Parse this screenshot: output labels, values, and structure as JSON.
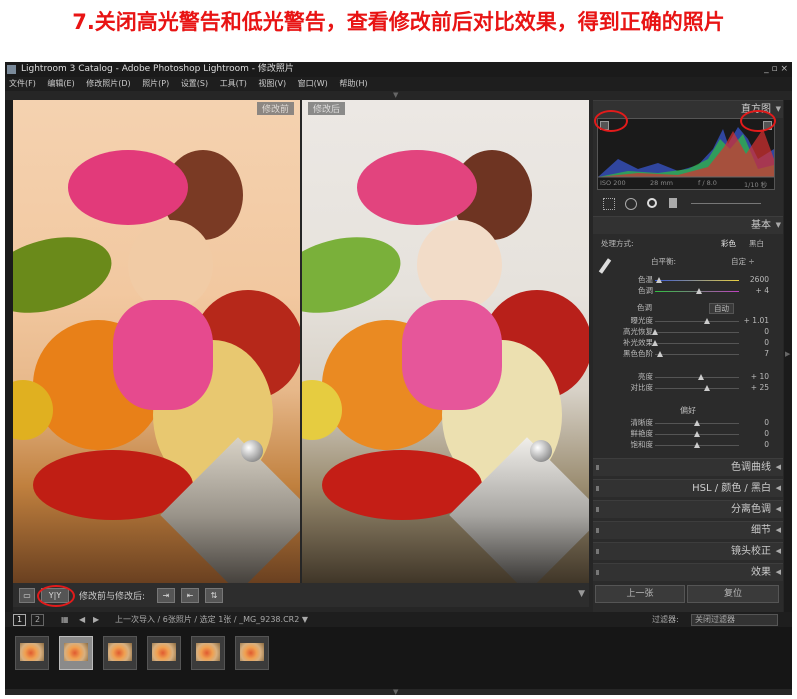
{
  "heading": "7.关闭高光警告和低光警告，查看修改前后对比效果，得到正确的照片",
  "titlebar": {
    "title": "Lightroom 3 Catalog - Adobe Photoshop Lightroom - 修改照片",
    "controls": "_ ▫ ×"
  },
  "menu": [
    "文件(F)",
    "编辑(E)",
    "修改照片(D)",
    "照片(P)",
    "设置(S)",
    "工具(T)",
    "视图(V)",
    "窗口(W)",
    "帮助(H)"
  ],
  "photos": {
    "before_label": "修改前",
    "after_label": "修改后"
  },
  "toolbar": {
    "yy_label": "Y|Y",
    "compare_label": "修改前与修改后:",
    "dropdown": "▼"
  },
  "panel": {
    "histogram_title": "直方图",
    "hist_info": [
      "ISO 200",
      "28 mm",
      "f / 8.0",
      "1/10 秒"
    ],
    "basic_title": "基本",
    "treatment_label": "处理方式:",
    "color_opt": "彩色",
    "bw_opt": "黑白",
    "wb_label": "白平衡:",
    "wb_value": "自定 ÷",
    "temp": {
      "label": "色温",
      "value": "2600",
      "pos": 0.05
    },
    "tint": {
      "label": "色调",
      "value": "+ 4",
      "pos": 0.52
    },
    "tone_label": "色调",
    "auto_label": "自动",
    "tone": [
      {
        "label": "曝光度",
        "value": "+ 1.01",
        "pos": 0.62
      },
      {
        "label": "高光恢复",
        "value": "0",
        "pos": 0.0
      },
      {
        "label": "补光效果",
        "value": "0",
        "pos": 0.0
      },
      {
        "label": "黑色色阶",
        "value": "7",
        "pos": 0.06
      }
    ],
    "presence": [
      {
        "label": "亮度",
        "value": "+ 10",
        "pos": 0.55
      },
      {
        "label": "对比度",
        "value": "+ 25",
        "pos": 0.62
      }
    ],
    "presence_label": "偏好",
    "presence2": [
      {
        "label": "清晰度",
        "value": "0",
        "pos": 0.5
      },
      {
        "label": "鲜艳度",
        "value": "0",
        "pos": 0.5
      },
      {
        "label": "饱和度",
        "value": "0",
        "pos": 0.5
      }
    ],
    "sections": [
      "色调曲线",
      "HSL / 颜色 / 黑白",
      "分离色调",
      "细节",
      "镜头校正",
      "效果"
    ],
    "prev_button": "上一张",
    "reset_button": "复位"
  },
  "filmbar": {
    "page1": "1",
    "page2": "2",
    "path": "上一次导入 / 6张照片 / 选定 1张 / _MG_9238.CR2 ▼",
    "filter_label": "过滤器:",
    "filter_value": "关闭过滤器"
  },
  "thumb_count": 6,
  "colors": {
    "heading": "#e81414",
    "circle": "#e21b1b"
  }
}
